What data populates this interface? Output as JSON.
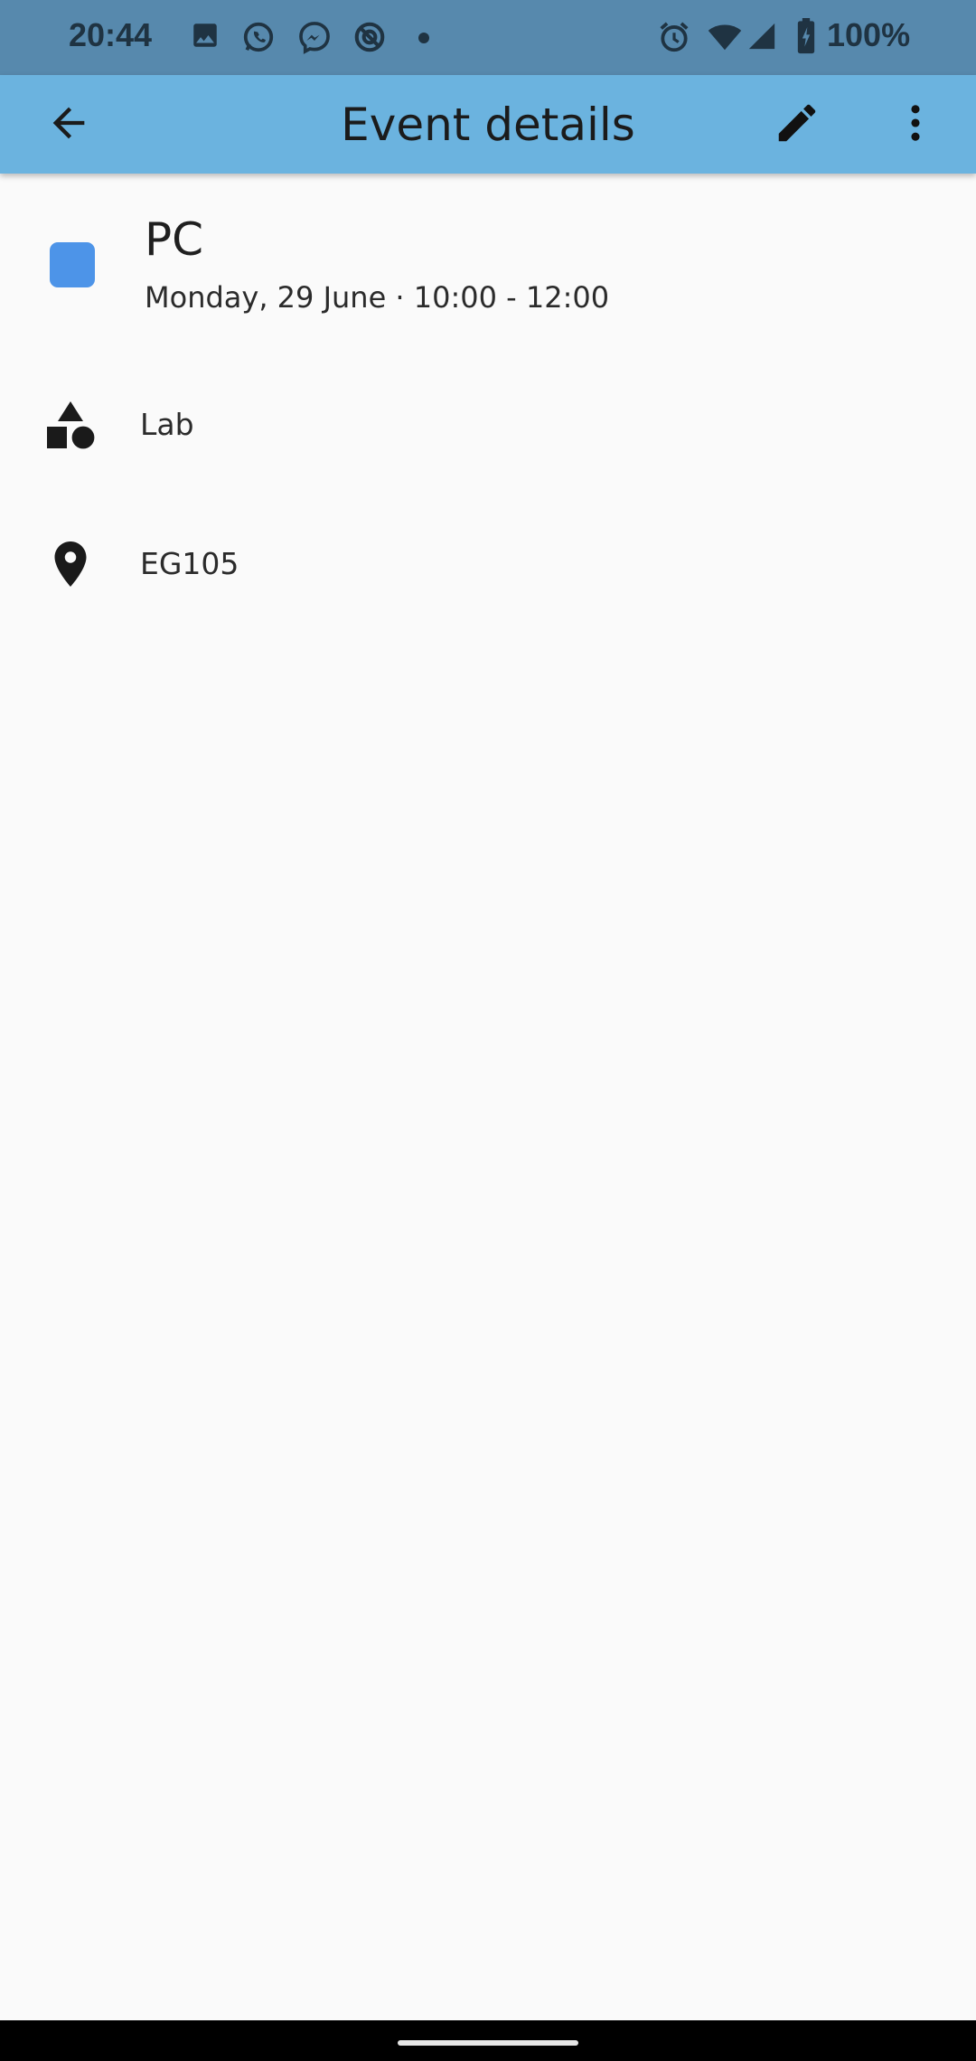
{
  "status_bar": {
    "time": "20:44",
    "battery": "100%",
    "left_icons": [
      "gallery-icon",
      "whatsapp-icon",
      "messenger-icon",
      "data-saver-icon",
      "dot-icon"
    ],
    "right_icons": [
      "alarm-icon",
      "wifi-icon",
      "cell-signal-icon",
      "battery-icon"
    ]
  },
  "app_bar": {
    "title": "Event details",
    "back_icon": "arrow-back-icon",
    "edit_icon": "pencil-icon",
    "more_icon": "more-vert-icon"
  },
  "event": {
    "title": "PC",
    "datetime": "Monday, 29 June · 10:00 - 12:00",
    "color": "#4d94e8"
  },
  "details": {
    "type": {
      "icon": "category-shapes-icon",
      "label": "Lab"
    },
    "location": {
      "icon": "location-pin-icon",
      "label": "EG105"
    }
  },
  "colors": {
    "status_bar": "#5789ad",
    "app_bar": "#6bb3df",
    "background": "#fafafa"
  }
}
